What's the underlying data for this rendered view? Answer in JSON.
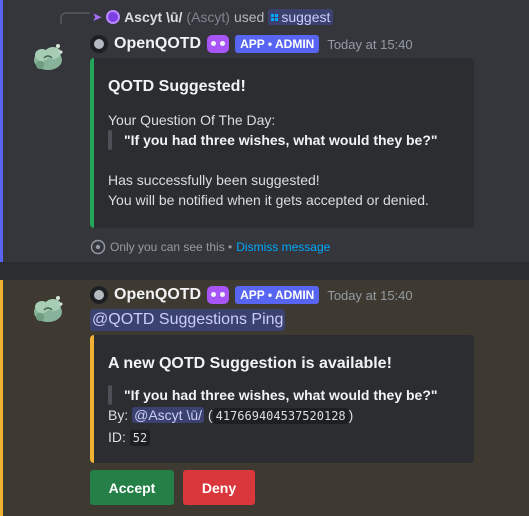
{
  "reply": {
    "user_name": "Ascyt \\ū/",
    "user_sub": "(Ascyt)",
    "used_text": "used",
    "command": "suggest"
  },
  "message1": {
    "bot_name": "OpenQOTD",
    "badge": "APP • ADMIN",
    "timestamp": "Today at 15:40",
    "embed": {
      "title": "QOTD Suggested!",
      "label": "Your Question Of The Day:",
      "question": "\"If you had three wishes, what would they be?\"",
      "line1": "Has successfully been suggested!",
      "line2": "You will be notified when it gets accepted or denied.",
      "color": "#23a55a"
    },
    "ephemeral_text": "Only you can see this •",
    "dismiss_text": "Dismiss message"
  },
  "message2": {
    "bot_name": "OpenQOTD",
    "badge": "APP • ADMIN",
    "timestamp": "Today at 15:40",
    "ping": "@QOTD Suggestions Ping",
    "embed": {
      "title": "A new QOTD Suggestion is available!",
      "question": "\"If you had three wishes, what would they be?\"",
      "by_label": "By:",
      "by_mention": "@Ascyt \\ū/",
      "user_id": "417669404537520128",
      "id_label": "ID:",
      "id_value": "52",
      "color": "#f0b232"
    },
    "buttons": {
      "accept": "Accept",
      "deny": "Deny"
    }
  },
  "icons": [
    "command-icon",
    "bot-avatar",
    "status-icon",
    "bot-emoji-icon",
    "eye-icon",
    "slash-command-icon"
  ],
  "colors": {
    "blurple": "#5865f2",
    "accept": "#248046",
    "deny": "#da373c",
    "link": "#00a8fc"
  }
}
